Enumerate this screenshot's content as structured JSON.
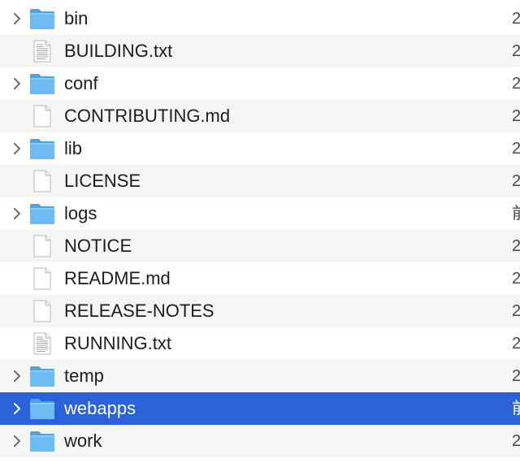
{
  "colors": {
    "selection": "#2a62d9",
    "stripe": "#f4f5f5",
    "folder": "#63b5f0",
    "text": "#1d1d1f"
  },
  "rows": [
    {
      "name": "bin",
      "type": "folder",
      "date": "2",
      "selected": false
    },
    {
      "name": "BUILDING.txt",
      "type": "text-document",
      "date": "2",
      "selected": false
    },
    {
      "name": "conf",
      "type": "folder",
      "date": "2",
      "selected": false
    },
    {
      "name": "CONTRIBUTING.md",
      "type": "document",
      "date": "2",
      "selected": false
    },
    {
      "name": "lib",
      "type": "folder",
      "date": "2",
      "selected": false
    },
    {
      "name": "LICENSE",
      "type": "document",
      "date": "2",
      "selected": false
    },
    {
      "name": "logs",
      "type": "folder",
      "date": "前",
      "selected": false
    },
    {
      "name": "NOTICE",
      "type": "document",
      "date": "2",
      "selected": false
    },
    {
      "name": "README.md",
      "type": "document",
      "date": "2",
      "selected": false
    },
    {
      "name": "RELEASE-NOTES",
      "type": "document",
      "date": "2",
      "selected": false
    },
    {
      "name": "RUNNING.txt",
      "type": "text-document",
      "date": "2",
      "selected": false
    },
    {
      "name": "temp",
      "type": "folder",
      "date": "2",
      "selected": false
    },
    {
      "name": "webapps",
      "type": "folder",
      "date": "前",
      "selected": true
    },
    {
      "name": "work",
      "type": "folder",
      "date": "2",
      "selected": false
    }
  ]
}
